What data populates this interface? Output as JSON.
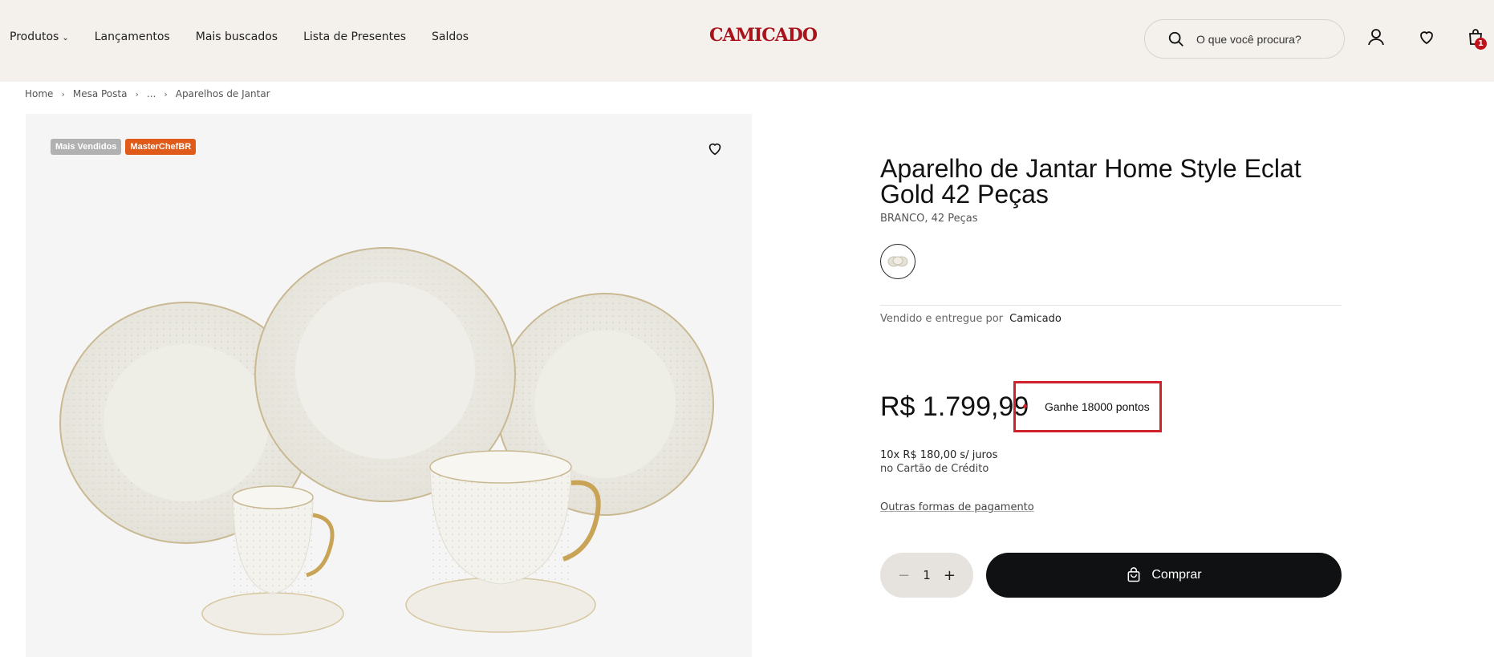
{
  "header": {
    "nav": [
      {
        "label": "Produtos",
        "has_dropdown": true
      },
      {
        "label": "Lançamentos"
      },
      {
        "label": "Mais buscados"
      },
      {
        "label": "Lista de Presentes"
      },
      {
        "label": "Saldos"
      }
    ],
    "logo": "CAMICADO",
    "search_placeholder": "O que você procura?",
    "cart_count": "1",
    "brand_color": "#a8131c"
  },
  "breadcrumb": [
    "Home",
    "Mesa Posta",
    "...",
    "Aparelhos de Jantar"
  ],
  "gallery": {
    "badges": [
      {
        "label": "Mais Vendidos",
        "color": "#b1b1b1"
      },
      {
        "label": "MasterChefBR",
        "color": "#e05a1a"
      }
    ],
    "favorite_icon": "heart-icon"
  },
  "product": {
    "title": "Aparelho de Jantar Home Style Eclat Gold 42 Peças",
    "variant": "BRANCO, 42 Peças",
    "seller_label": "Vendido e entregue por",
    "seller_name": "Camicado",
    "price": "R$ 1.799,99",
    "points": "Ganhe 18000 pontos",
    "installments": "10x R$ 180,00 s/ juros",
    "installments_sub": "no Cartão de Crédito",
    "other_payments": "Outras formas de pagamento",
    "quantity": "1",
    "buy_label": "Comprar"
  }
}
